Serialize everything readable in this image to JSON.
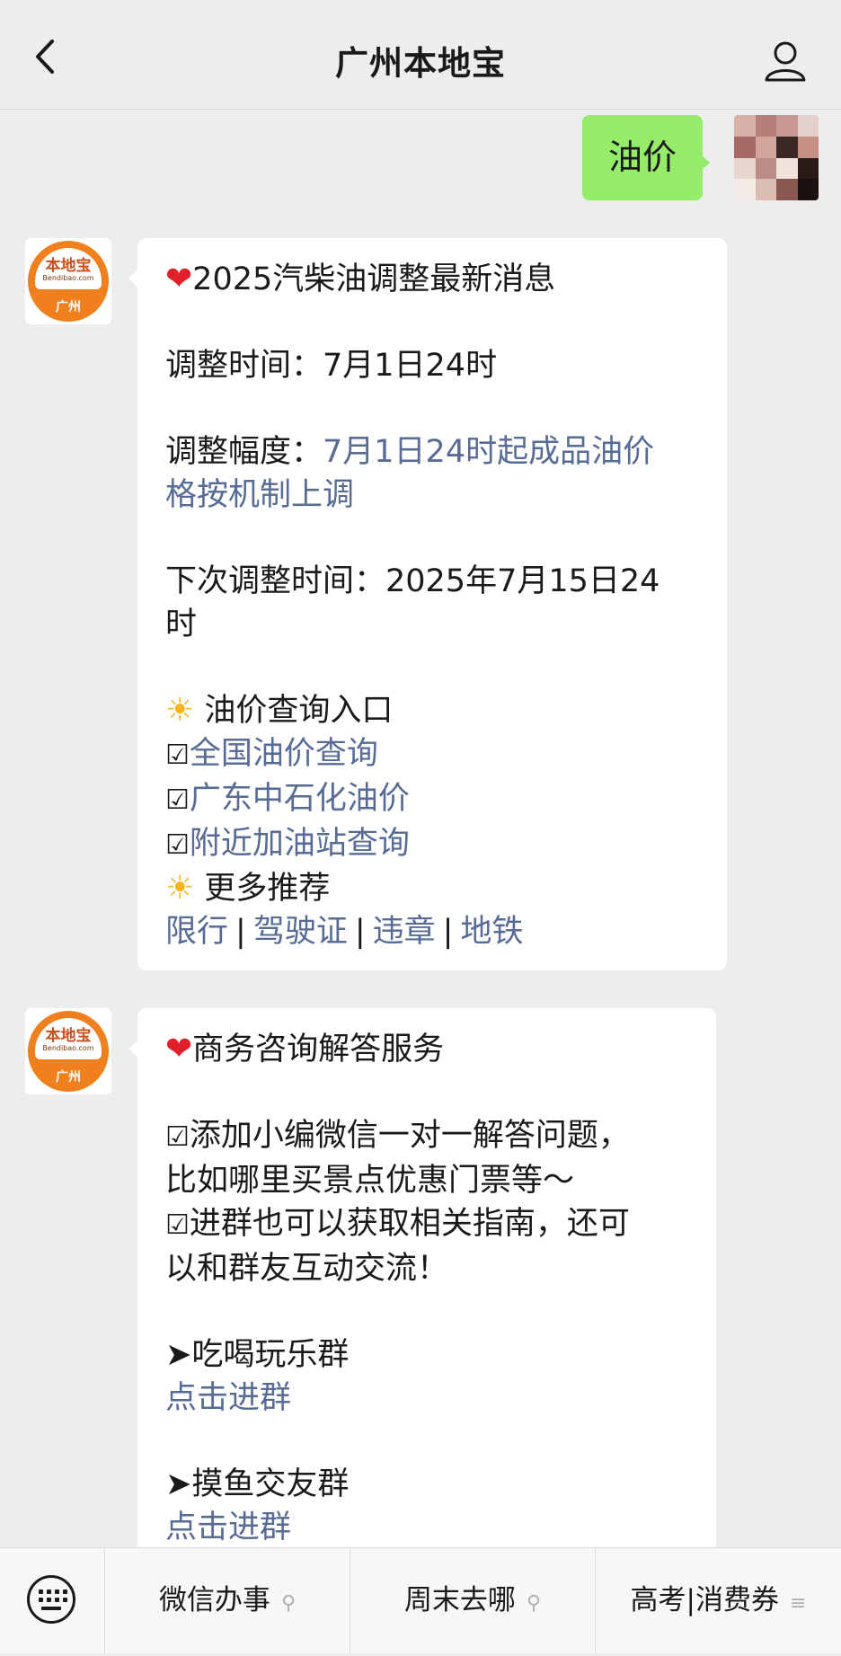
{
  "header": {
    "title": "广州本地宝"
  },
  "sent": {
    "text": "油价"
  },
  "bot": {
    "brand": "本地宝",
    "sub": "Bendibao.com",
    "city": "广州"
  },
  "msg1": {
    "heading": "2025汽柴油调整最新消息",
    "adjust_time": "调整时间：7月1日24时",
    "range_label": "调整幅度：",
    "range_link_1": "7月1日24时起成品油价",
    "range_link_2": "格按机制上调",
    "next_time_1": "下次调整时间：2025年7月15日24",
    "next_time_2": "时",
    "query_title": "油价查询入口",
    "links": [
      "全国油价查询",
      "广东中石化油价",
      "附近加油站查询"
    ],
    "more_title": "更多推荐",
    "more_links": [
      "限行",
      "驾驶证",
      "违章",
      "地铁"
    ],
    "separator": "|"
  },
  "msg2": {
    "heading": "商务咨询解答服务",
    "p1a": "添加小编微信一对一解答问题，",
    "p1b": "比如哪里买景点优惠门票等～",
    "p2a": "进群也可以获取相关指南，还可",
    "p2b": "以和群友互动交流！",
    "group1": "➤吃喝玩乐群",
    "join1": "点击进群",
    "group2": "➤摸鱼交友群",
    "join2": "点击进群"
  },
  "glyphs": {
    "heart": "❤",
    "sun": "☀",
    "check": "☑"
  },
  "bottom_menu": [
    "微信办事",
    "周末去哪",
    "高考|消费券"
  ],
  "colors": {
    "sent_bubble": "#95ec69",
    "link": "#576b95",
    "brand_orange": "#f07f1d"
  }
}
